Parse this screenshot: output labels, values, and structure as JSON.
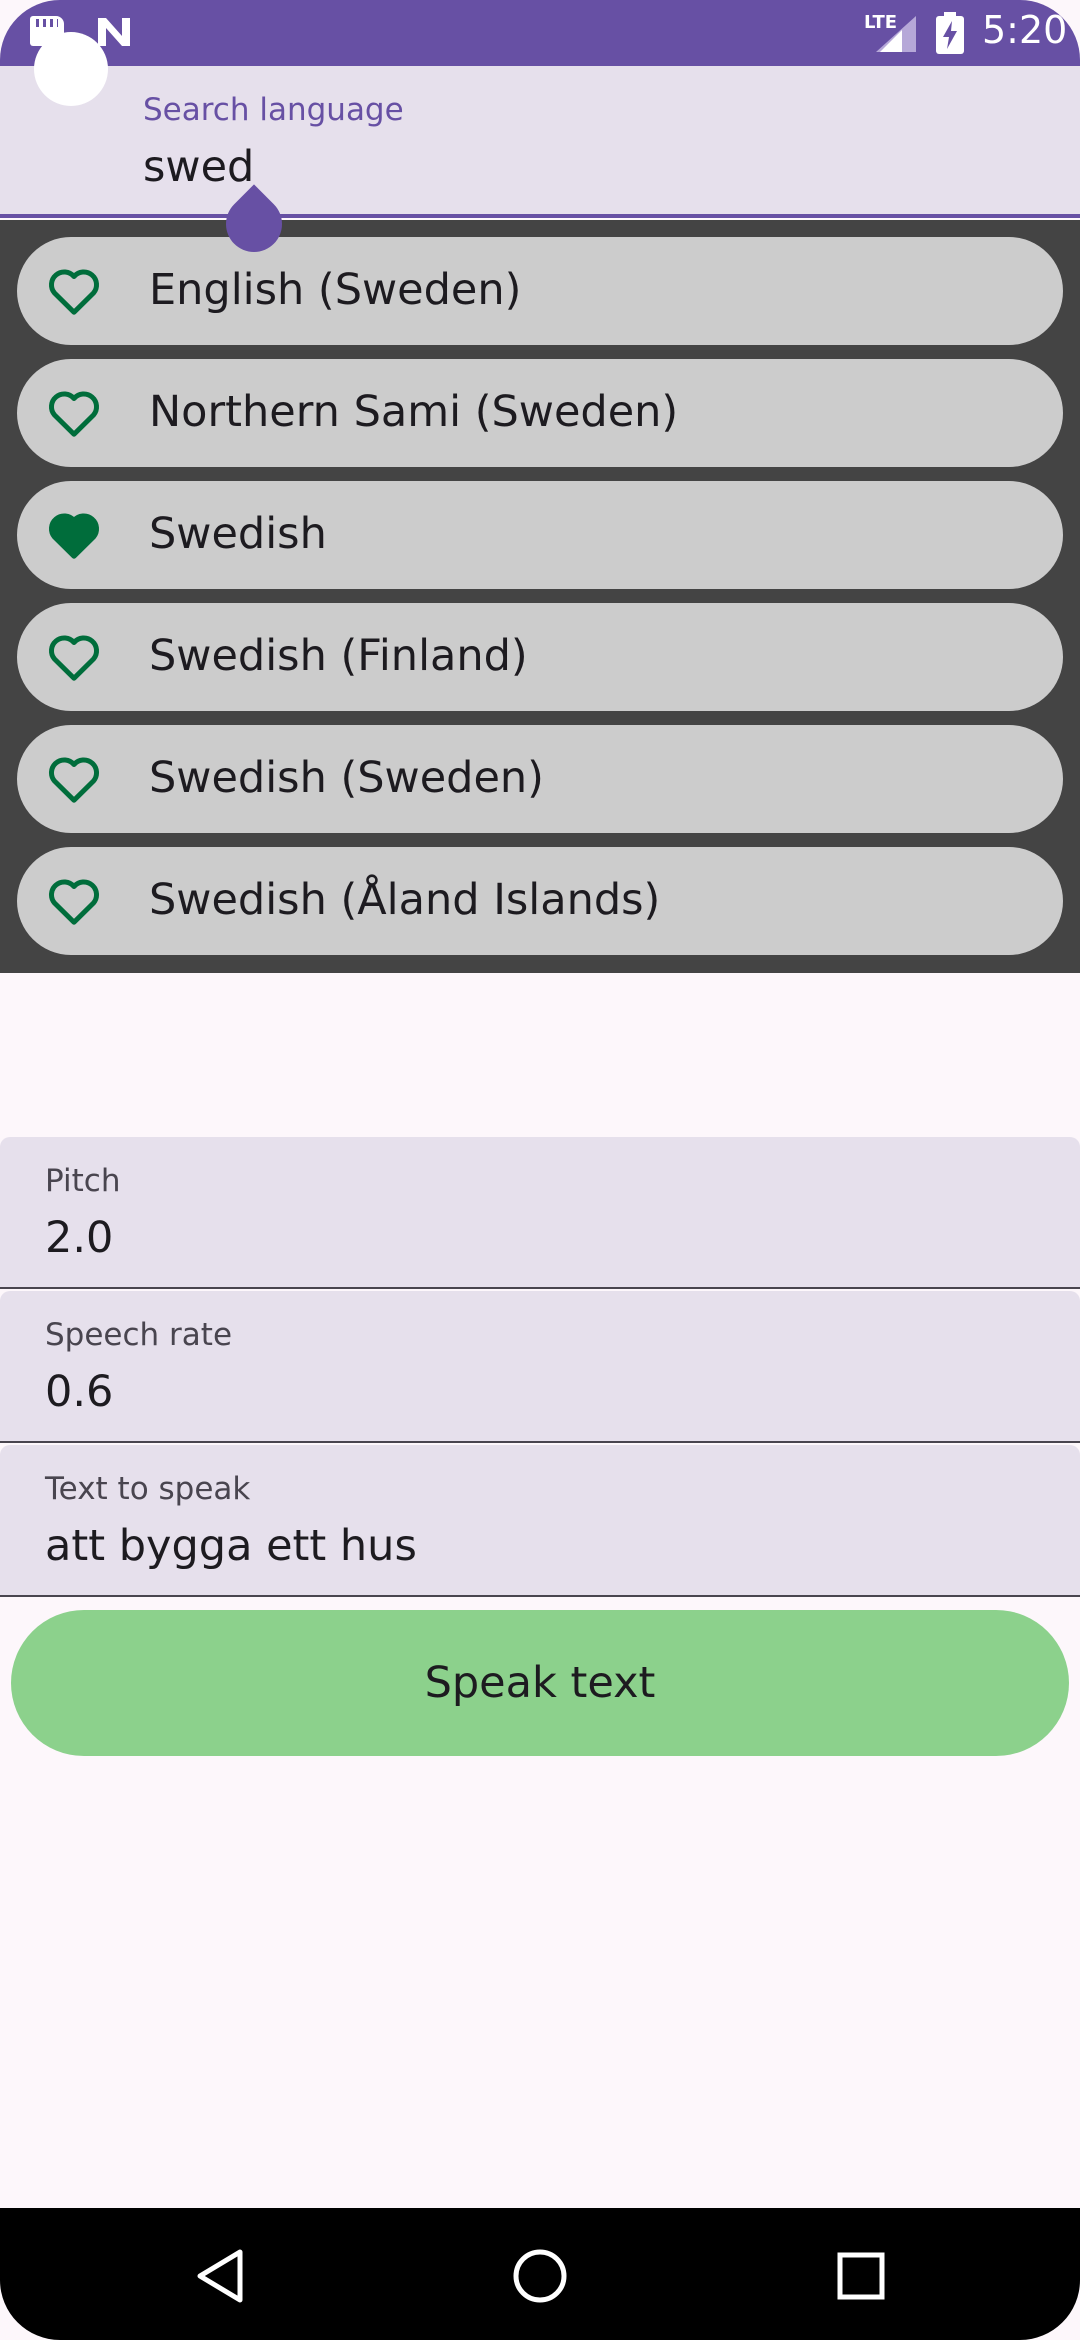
{
  "status_bar": {
    "network": "LTE",
    "time": "5:20",
    "icons": [
      "sd-card-icon",
      "n-icon",
      "signal-icon",
      "battery-charging-icon"
    ]
  },
  "search": {
    "label": "Search language",
    "value": "swed"
  },
  "languages": [
    {
      "label": "English (Sweden)",
      "favorite": false
    },
    {
      "label": "Northern Sami (Sweden)",
      "favorite": false
    },
    {
      "label": "Swedish",
      "favorite": true
    },
    {
      "label": "Swedish (Finland)",
      "favorite": false
    },
    {
      "label": "Swedish (Sweden)",
      "favorite": false
    },
    {
      "label": "Swedish (Åland Islands)",
      "favorite": false
    }
  ],
  "fields": {
    "pitch": {
      "label": "Pitch",
      "value": "2.0"
    },
    "speech_rate": {
      "label": "Speech rate",
      "value": "0.6"
    },
    "text_to_speak": {
      "label": "Text to speak",
      "value": "att bygga ett hus"
    }
  },
  "speak_button": {
    "label": "Speak text"
  },
  "colors": {
    "primary": "#6750a4",
    "heart": "#006d3b",
    "button": "#8cd18c",
    "dropdown_bg": "#444444",
    "item_bg": "#cccccc"
  },
  "nav": {
    "icons": [
      "back-icon",
      "home-icon",
      "recents-icon"
    ]
  }
}
